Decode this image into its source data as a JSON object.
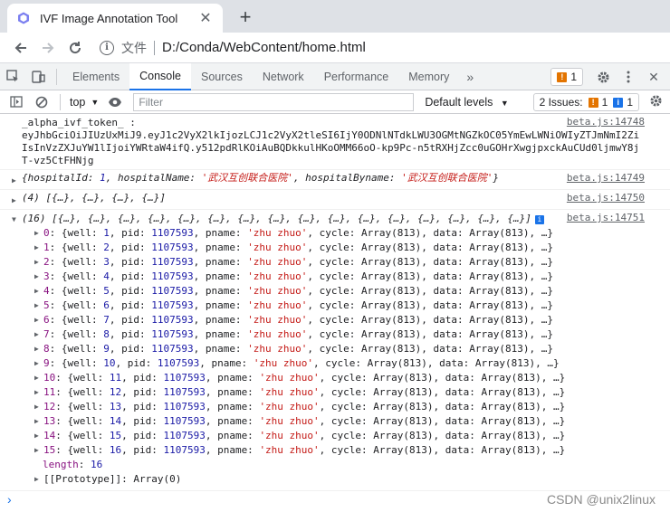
{
  "browser": {
    "tab_title": "IVF Image Annotation Tool",
    "tab_close_glyph": "✕",
    "new_tab_glyph": "+",
    "file_label": "文件",
    "url": "D:/Conda/WebContent/home.html"
  },
  "devtools": {
    "tabs": [
      "Elements",
      "Console",
      "Sources",
      "Network",
      "Performance",
      "Memory"
    ],
    "more_tabs": "»",
    "warning_count": "1",
    "close_glyph": "✕"
  },
  "console_toolbar": {
    "context": "top",
    "filter_placeholder": "Filter",
    "levels": "Default levels",
    "issues_label": "2 Issues:",
    "issues_warn": "1",
    "issues_info": "1"
  },
  "messages": {
    "token_label": "_alpha_ivf_token_ :",
    "token_value": "eyJhbGciOiJIUzUxMiJ9.eyJ1c2VyX2lkIjozLCJ1c2VyX2tleSI6IjY0ODNlNTdkLWU3OGMtNGZkOC05YmEwLWNiOWIyZTJmNmI2ZiIsInVzZXJuYW1lIjoiYWRtaW4ifQ.y512pdRlKOiAuBQDkkulHKoOMM66oO-kp9Pc-n5tRXHjZcc0uGOHrXwgjpxckAuCUd0ljmwY8jT-vz5CtFHNjg",
    "src1": "beta.js:14748",
    "hospital_prefix": "{hospitalId: ",
    "hospital_id": "1",
    "hospital_name_key": ", hospitalName: ",
    "hospital_name": "'武汉互创联合医院'",
    "hospital_byname_key": ", hospitalByname: ",
    "hospital_byname": "'武汉互创联合医院'",
    "hospital_suffix": "}",
    "src2": "beta.js:14749",
    "arr4": "(4) [{…}, {…}, {…}, {…}]",
    "src3": "beta.js:14750",
    "arr16": "(16) [{…}, {…}, {…}, {…}, {…}, {…}, {…}, {…}, {…}, {…}, {…}, {…}, {…}, {…}, {…}, {…}]",
    "src4": "beta.js:14751",
    "rows": [
      {
        "idx": "0",
        "well": "1"
      },
      {
        "idx": "1",
        "well": "2"
      },
      {
        "idx": "2",
        "well": "3"
      },
      {
        "idx": "3",
        "well": "4"
      },
      {
        "idx": "4",
        "well": "5"
      },
      {
        "idx": "5",
        "well": "6"
      },
      {
        "idx": "6",
        "well": "7"
      },
      {
        "idx": "7",
        "well": "8"
      },
      {
        "idx": "8",
        "well": "9"
      },
      {
        "idx": "9",
        "well": "10"
      },
      {
        "idx": "10",
        "well": "11"
      },
      {
        "idx": "11",
        "well": "12"
      },
      {
        "idx": "12",
        "well": "13"
      },
      {
        "idx": "13",
        "well": "14"
      },
      {
        "idx": "14",
        "well": "15"
      },
      {
        "idx": "15",
        "well": "16"
      }
    ],
    "row_pid": "1107593",
    "row_pname": "'zhu zhuo'",
    "row_cycle": "Array(813)",
    "row_data": "Array(813)",
    "length_key": "length",
    "length_value": "16",
    "prototype": "[[Prototype]]: Array(0)"
  },
  "prompt_glyph": "›",
  "watermark": "CSDN @unix2linux"
}
